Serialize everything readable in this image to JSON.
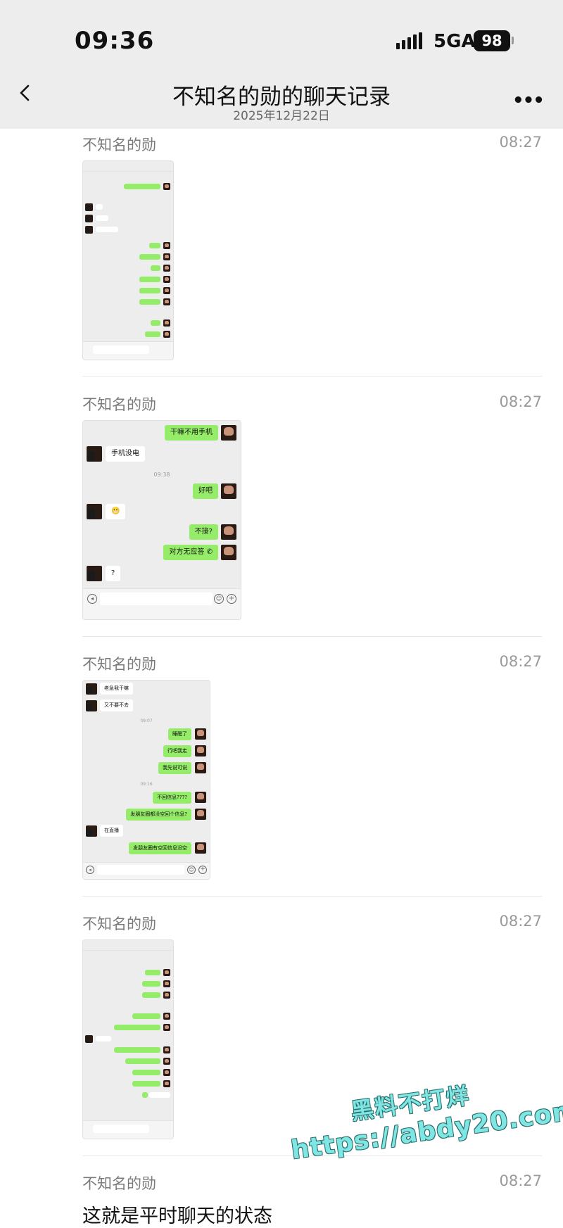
{
  "status_bar": {
    "time": "09:36",
    "network": "5GA",
    "battery": "98"
  },
  "nav": {
    "title": "不知名的勋的聊天记录",
    "date": "2025年12月22日"
  },
  "messages": [
    {
      "sender": "不知名的勋",
      "time": "08:27",
      "type": "image"
    },
    {
      "sender": "不知名的勋",
      "time": "08:27",
      "type": "image"
    },
    {
      "sender": "不知名的勋",
      "time": "08:27",
      "type": "image"
    },
    {
      "sender": "不知名的勋",
      "time": "08:27",
      "type": "image"
    },
    {
      "sender": "不知名的勋",
      "time": "08:27",
      "type": "text",
      "text": "这就是平时聊天的状态"
    }
  ],
  "screenshot_2": {
    "lines": [
      "干嘛不用手机",
      "手机没电",
      "09:38",
      "好吧",
      "😬",
      "不接?",
      "对方无应答 ✆",
      "?"
    ]
  },
  "screenshot_3": {
    "lines": [
      "老急我干嘛",
      "又不要不去",
      "09:07",
      "睡醒了",
      "行吧我走",
      "我先说可说",
      "09:16",
      "不回信息????",
      "发朋友圈都没空回个信息?",
      "在直播",
      "发朋友圈有空回信息没空"
    ]
  },
  "watermark": {
    "line1": "黑料不打烊",
    "line2": "https://abdy20.com"
  },
  "colors": {
    "outgoing_bubble": "#95ec69",
    "header_bg": "#ededed",
    "watermark": "#7fe6e4"
  }
}
